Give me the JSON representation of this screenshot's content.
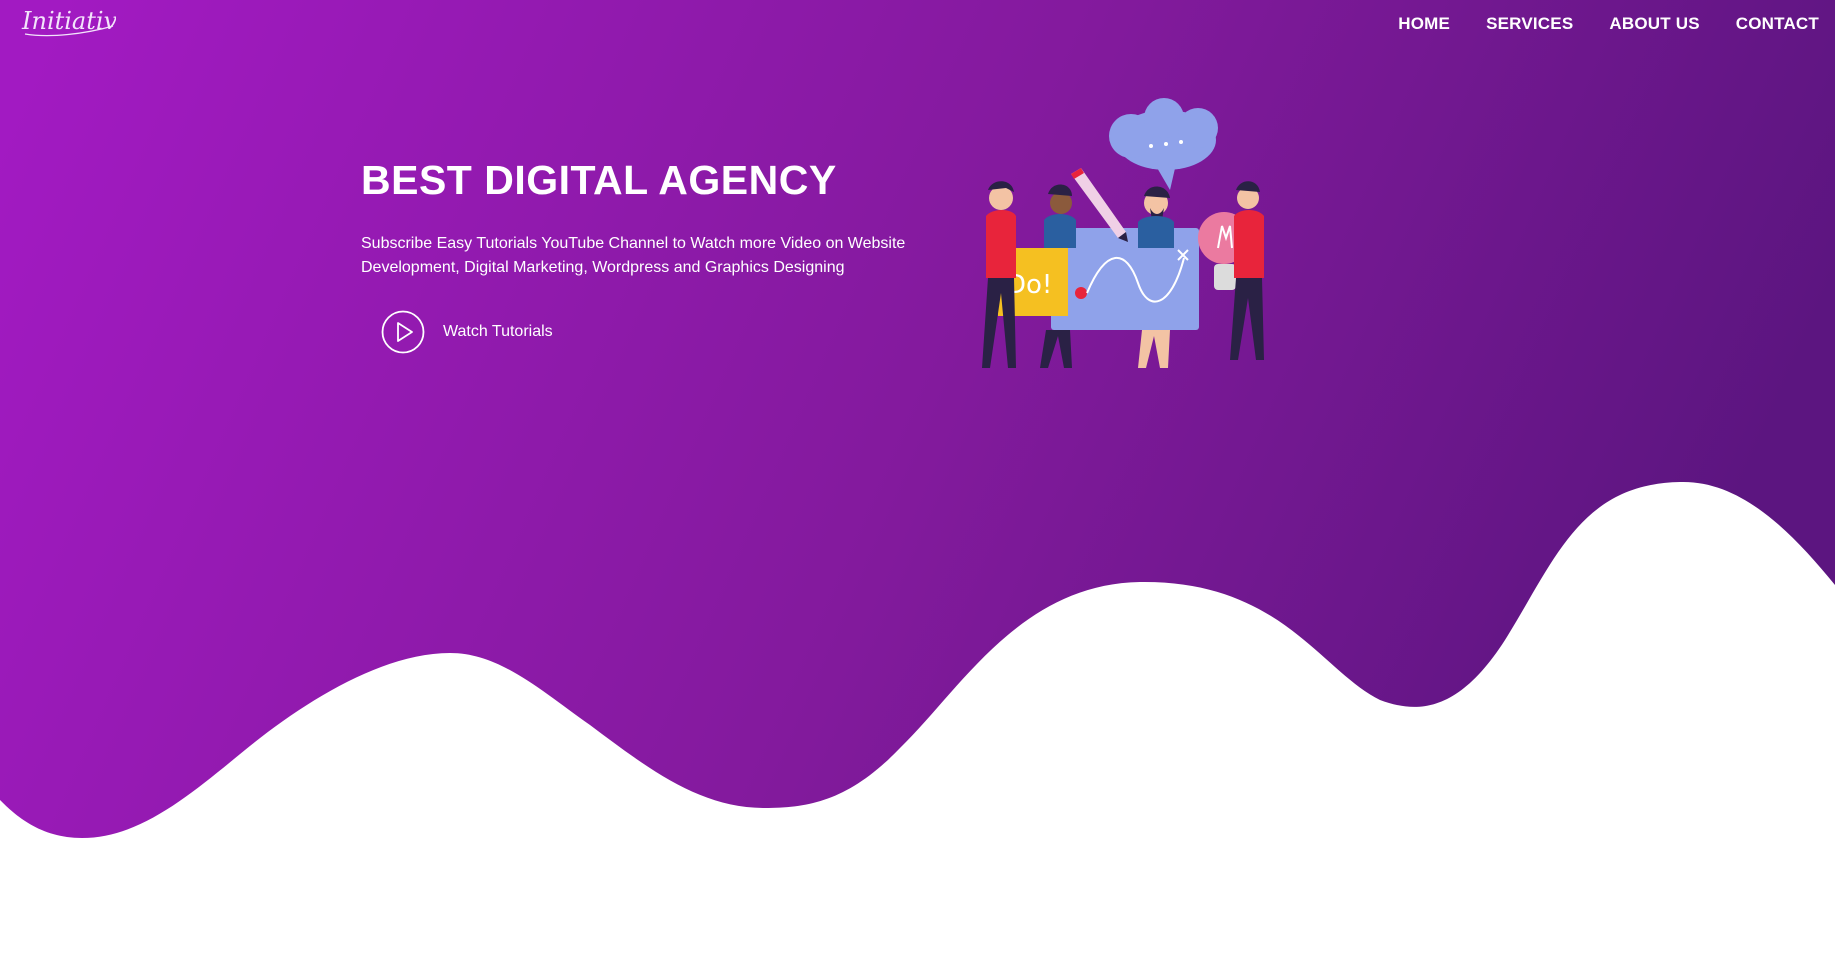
{
  "brand": {
    "logo_text": "Initiative"
  },
  "nav": {
    "items": [
      {
        "label": "HOME"
      },
      {
        "label": "SERVICES"
      },
      {
        "label": "ABOUT US"
      },
      {
        "label": "CONTACT"
      }
    ]
  },
  "hero": {
    "title": "BEST DIGITAL AGENCY",
    "text": "Subscribe Easy Tutorials YouTube Channel to Watch more Video on Website Development, Digital Marketing, Wordpress and Graphics Designing",
    "cta_label": "Watch Tutorials",
    "cta_icon": "play-circle-icon",
    "illustration_sign_text": "Do!"
  },
  "colors": {
    "gradient_start": "#a21ac2",
    "gradient_mid": "#8a1a9f",
    "gradient_end": "#5c1580",
    "text": "#ffffff",
    "wave_fill": "#ffffff"
  }
}
